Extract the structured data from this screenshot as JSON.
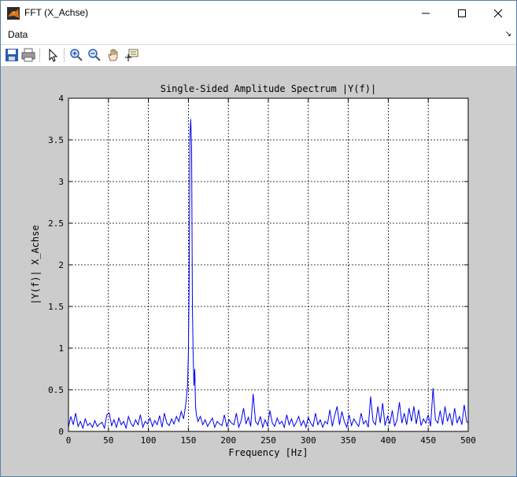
{
  "window": {
    "title": "FFT (X_Achse)",
    "menu_data": "Data",
    "menu_arrow": "↘",
    "buttons": {
      "minimize": "—",
      "maximize": "☐",
      "close": "✕"
    }
  },
  "toolbar": {
    "icons": [
      "save-icon",
      "print-icon",
      "pointer-icon",
      "zoom-in-icon",
      "zoom-out-icon",
      "pan-icon",
      "data-cursor-icon"
    ]
  },
  "colors": {
    "accent": "#0000ee",
    "figure_bg": "#cccccc"
  },
  "chart_data": {
    "type": "line",
    "title": "Single-Sided Amplitude Spectrum |Y(f)|",
    "xlabel": "Frequency [Hz]",
    "ylabel": "|Y(f)| X_Achse",
    "xlim": [
      0,
      500
    ],
    "ylim": [
      0,
      4
    ],
    "xticks": [
      0,
      50,
      100,
      150,
      200,
      250,
      300,
      350,
      400,
      450,
      500
    ],
    "yticks": [
      0,
      0.5,
      1,
      1.5,
      2,
      2.5,
      3,
      3.5,
      4
    ],
    "grid": true,
    "series": [
      {
        "color": "#0000ee",
        "x": [
          0,
          3,
          6,
          9,
          12,
          15,
          18,
          21,
          24,
          27,
          30,
          33,
          36,
          39,
          42,
          45,
          48,
          51,
          54,
          57,
          60,
          63,
          66,
          69,
          72,
          75,
          78,
          81,
          84,
          87,
          90,
          93,
          96,
          99,
          102,
          105,
          108,
          111,
          114,
          117,
          120,
          123,
          126,
          129,
          132,
          135,
          138,
          141,
          144,
          147,
          149,
          150,
          151,
          152,
          153,
          154,
          155,
          156,
          157,
          158,
          159,
          160,
          162,
          165,
          168,
          171,
          174,
          177,
          180,
          183,
          186,
          189,
          192,
          195,
          198,
          201,
          204,
          207,
          210,
          213,
          216,
          219,
          222,
          225,
          228,
          231,
          234,
          237,
          240,
          243,
          246,
          249,
          252,
          255,
          258,
          261,
          264,
          267,
          270,
          273,
          276,
          279,
          282,
          285,
          288,
          291,
          294,
          297,
          300,
          303,
          306,
          309,
          312,
          315,
          318,
          321,
          324,
          327,
          330,
          333,
          336,
          339,
          342,
          345,
          348,
          351,
          354,
          357,
          360,
          363,
          366,
          369,
          372,
          375,
          378,
          381,
          384,
          387,
          390,
          393,
          396,
          399,
          402,
          405,
          408,
          411,
          414,
          417,
          420,
          423,
          426,
          429,
          432,
          435,
          438,
          441,
          444,
          447,
          450,
          453,
          456,
          459,
          462,
          465,
          468,
          471,
          474,
          477,
          480,
          483,
          486,
          489,
          492,
          495,
          498,
          500
        ],
        "y": [
          0.05,
          0.18,
          0.08,
          0.22,
          0.06,
          0.12,
          0.04,
          0.15,
          0.07,
          0.1,
          0.05,
          0.13,
          0.06,
          0.09,
          0.11,
          0.04,
          0.2,
          0.22,
          0.07,
          0.14,
          0.05,
          0.16,
          0.08,
          0.12,
          0.04,
          0.18,
          0.1,
          0.06,
          0.14,
          0.08,
          0.2,
          0.05,
          0.12,
          0.09,
          0.16,
          0.06,
          0.13,
          0.08,
          0.19,
          0.05,
          0.22,
          0.1,
          0.07,
          0.15,
          0.09,
          0.18,
          0.12,
          0.24,
          0.15,
          0.35,
          0.55,
          0.95,
          1.8,
          3.55,
          3.75,
          3.4,
          1.5,
          0.9,
          0.55,
          0.75,
          0.3,
          0.2,
          0.12,
          0.18,
          0.08,
          0.14,
          0.06,
          0.11,
          0.16,
          0.05,
          0.12,
          0.09,
          0.07,
          0.2,
          0.06,
          0.14,
          0.1,
          0.08,
          0.22,
          0.05,
          0.13,
          0.28,
          0.09,
          0.17,
          0.06,
          0.45,
          0.12,
          0.08,
          0.18,
          0.05,
          0.14,
          0.07,
          0.25,
          0.1,
          0.06,
          0.16,
          0.09,
          0.12,
          0.05,
          0.2,
          0.08,
          0.15,
          0.06,
          0.11,
          0.18,
          0.07,
          0.13,
          0.05,
          0.17,
          0.1,
          0.06,
          0.22,
          0.08,
          0.14,
          0.05,
          0.12,
          0.09,
          0.26,
          0.06,
          0.19,
          0.3,
          0.08,
          0.24,
          0.12,
          0.05,
          0.2,
          0.07,
          0.15,
          0.1,
          0.06,
          0.22,
          0.09,
          0.13,
          0.05,
          0.42,
          0.12,
          0.08,
          0.3,
          0.1,
          0.34,
          0.07,
          0.18,
          0.09,
          0.25,
          0.06,
          0.14,
          0.35,
          0.1,
          0.22,
          0.08,
          0.28,
          0.12,
          0.3,
          0.09,
          0.26,
          0.07,
          0.15,
          0.1,
          0.2,
          0.06,
          0.52,
          0.14,
          0.1,
          0.25,
          0.08,
          0.3,
          0.12,
          0.22,
          0.07,
          0.28,
          0.1,
          0.18,
          0.08,
          0.32,
          0.12,
          0.1
        ]
      }
    ]
  }
}
